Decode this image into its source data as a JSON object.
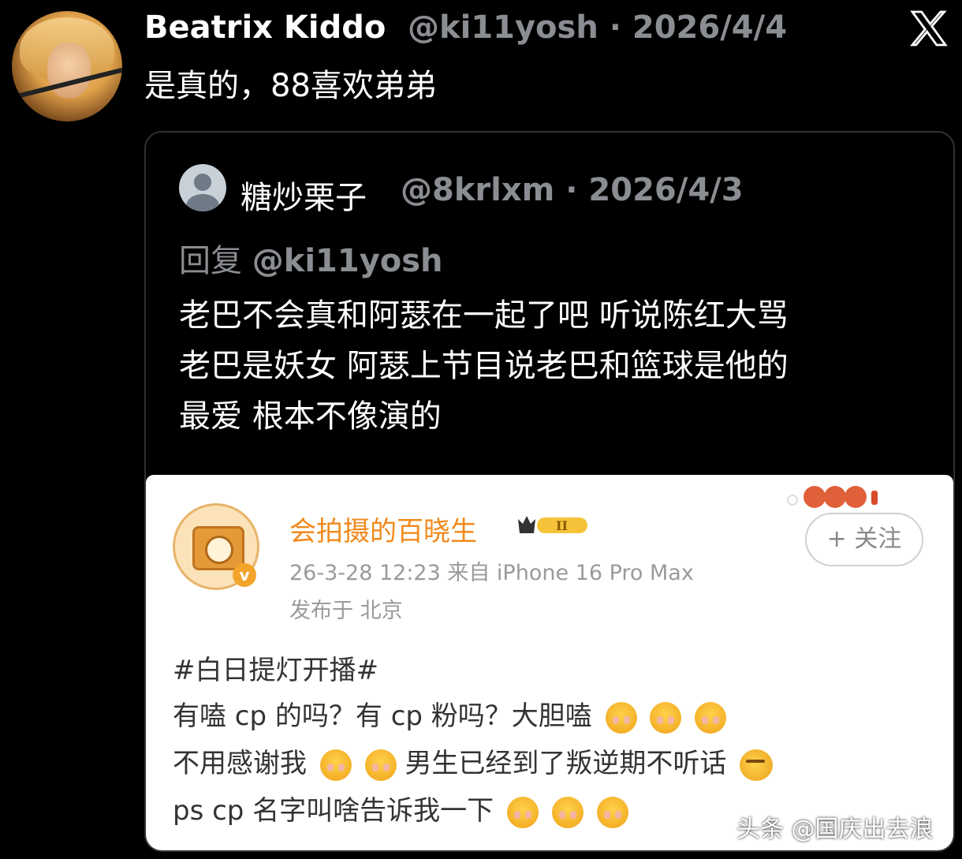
{
  "tweet": {
    "author_name": "Beatrix Kiddo",
    "author_handle_date": "@ki11yosh · 2026/4/4",
    "text": "是真的，88喜欢弟弟"
  },
  "quoted": {
    "author_name": "糖炒栗子",
    "author_handle_date": "@8krlxm · 2026/4/3",
    "reply_prefix": "回复",
    "reply_mention": "@ki11yosh",
    "body_lines": [
      "老巴不会真和阿瑟在一起了吧 听说陈红大骂",
      "老巴是妖女 阿瑟上节目说老巴和篮球是他的",
      "最爱 根本不像演的"
    ]
  },
  "weibo": {
    "name": "会拍摄的百晓生",
    "badge": "II",
    "meta": "26-3-28 12:23  来自 iPhone 16 Pro Max",
    "location": "发布于 北京",
    "follow_label": "+ 关注",
    "hashtag": "#白日提灯开播#",
    "line1": "有嗑 cp 的吗？有 cp 粉吗？大胆嗑",
    "line2a": "不用感谢我",
    "line2b": "男生已经到了叛逆期不听话",
    "line3": "ps cp 名字叫啥告诉我一下"
  },
  "icons": {
    "x_logo": "x-logo-icon",
    "emoji": "shy-emoji-icon",
    "smirk": "smirk-emoji-icon"
  },
  "watermark": "头条 @国庆出去浪"
}
